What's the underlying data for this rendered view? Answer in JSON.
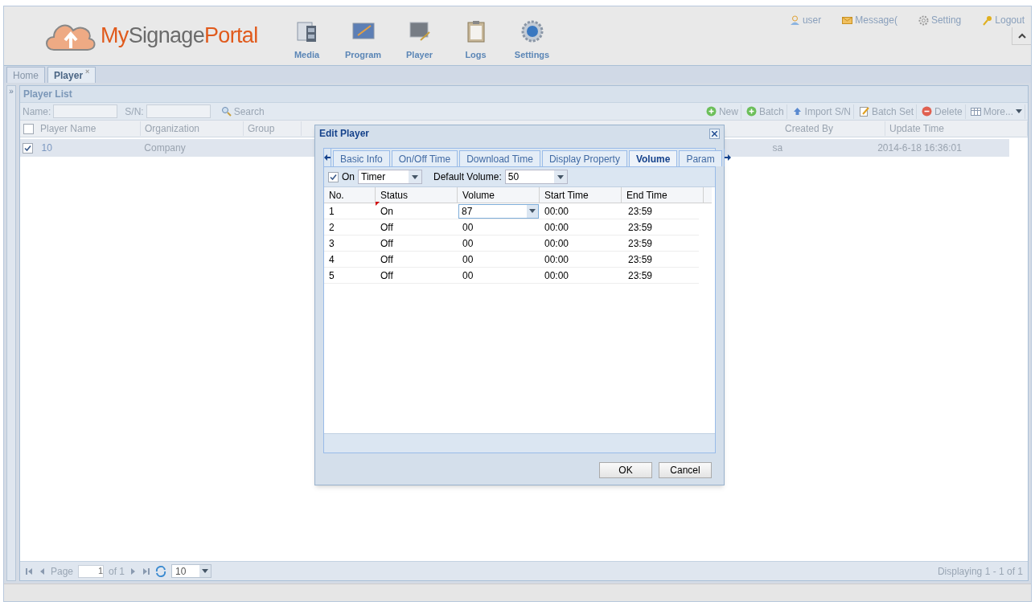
{
  "header": {
    "logo": {
      "part1": "MySignage",
      "part2": "Portal"
    },
    "nav": [
      {
        "label": "Media",
        "kind": "film"
      },
      {
        "label": "Program",
        "kind": "monitor"
      },
      {
        "label": "Player",
        "kind": "player"
      },
      {
        "label": "Logs",
        "kind": "clipboard"
      },
      {
        "label": "Settings",
        "kind": "gear"
      }
    ],
    "user_links": [
      {
        "label": "user",
        "kind": "user"
      },
      {
        "label": "Message(",
        "kind": "mail"
      },
      {
        "label": "Setting",
        "kind": "gear"
      },
      {
        "label": "Logout",
        "kind": "key"
      }
    ]
  },
  "tabs": [
    {
      "label": "Home",
      "selected": false
    },
    {
      "label": "Player",
      "selected": true,
      "close": "×"
    }
  ],
  "panel": {
    "title": "Player List",
    "collapse": "»",
    "filters": [
      {
        "label": "Name:"
      },
      {
        "label": "S/N:"
      }
    ],
    "search": "Search",
    "actions": [
      {
        "label": "New",
        "kind": "plus"
      },
      {
        "label": "Batch",
        "kind": "plus"
      },
      {
        "label": "Import S/N",
        "kind": "up"
      },
      {
        "label": "Batch Set",
        "kind": "edit"
      },
      {
        "label": "Delete",
        "kind": "minus"
      },
      {
        "label": "More...",
        "kind": "grid"
      }
    ],
    "columns": [
      "Player Name",
      "Organization",
      "Group",
      "Created By",
      "Update Time"
    ],
    "rows": [
      {
        "checked": true,
        "cells": [
          "10",
          "Company",
          null,
          "sa",
          "2014-6-18 16:36:01"
        ]
      }
    ],
    "all_checked": false,
    "pager": {
      "page_label": "Page",
      "page": "1",
      "of": "of 1",
      "page_size": "10",
      "status": "Displaying 1 - 1 of 1"
    }
  },
  "dialog": {
    "title": "Edit Player",
    "tabs": [
      {
        "label": "Basic Info",
        "selected": false
      },
      {
        "label": "On/Off Time",
        "selected": false
      },
      {
        "label": "Download Time",
        "selected": false
      },
      {
        "label": "Display Property",
        "selected": false
      },
      {
        "label": "Volume",
        "selected": true
      },
      {
        "label": "Param",
        "selected": false
      }
    ],
    "toolbar": {
      "on_label": "On",
      "on": true,
      "mode": "Timer",
      "default_label": "Default Volume:",
      "default_volume": "50"
    },
    "columns": [
      "No.",
      "Status",
      "Volume",
      "Start Time",
      "End Time"
    ],
    "rows": [
      {
        "no": "1",
        "status": "On",
        "volume": "87",
        "start": "00:00",
        "end": "23:59",
        "editing": true,
        "modified": true
      },
      {
        "no": "2",
        "status": "Off",
        "volume": "00",
        "start": "00:00",
        "end": "23:59",
        "editing": false,
        "modified": false
      },
      {
        "no": "3",
        "status": "Off",
        "volume": "00",
        "start": "00:00",
        "end": "23:59",
        "editing": false,
        "modified": false
      },
      {
        "no": "4",
        "status": "Off",
        "volume": "00",
        "start": "00:00",
        "end": "23:59",
        "editing": false,
        "modified": false
      },
      {
        "no": "5",
        "status": "Off",
        "volume": "00",
        "start": "00:00",
        "end": "23:59",
        "editing": false,
        "modified": false
      }
    ],
    "buttons": [
      "OK",
      "Cancel"
    ]
  }
}
